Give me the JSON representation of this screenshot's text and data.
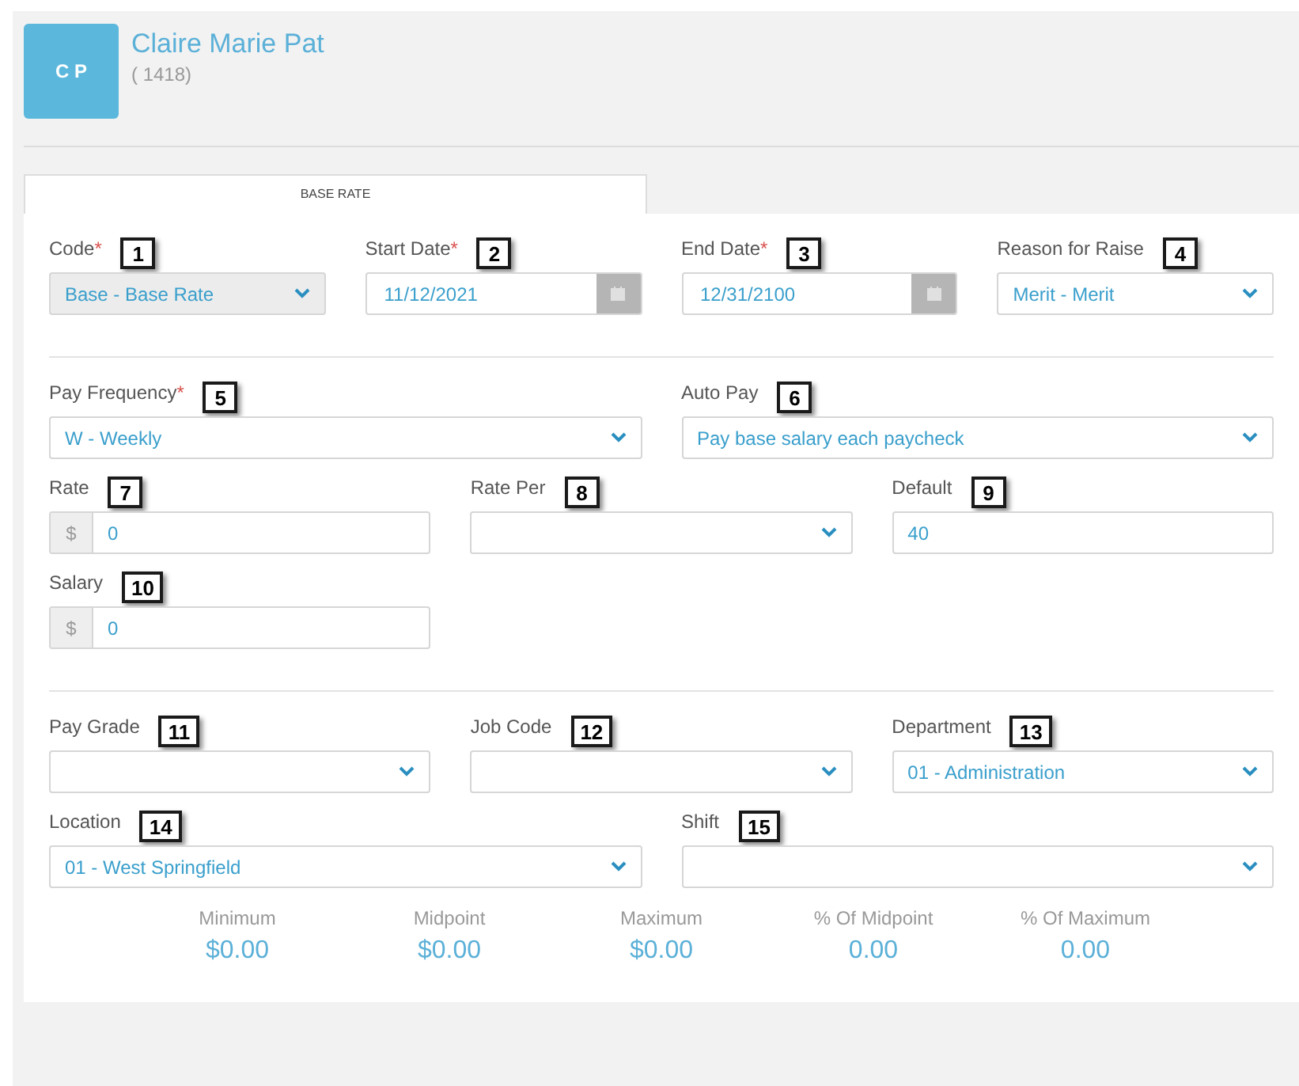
{
  "header": {
    "initials": "C P",
    "name": "Claire Marie Pat",
    "id": "( 1418)"
  },
  "tabs": [
    {
      "label": "BASE RATE",
      "selected": true
    }
  ],
  "sections": [
    {
      "rows": [
        {
          "fields": [
            {
              "kind": "select",
              "label": "Code",
              "required_mark": "*",
              "badge": "1",
              "value": "Base - Base Rate",
              "disabled": true
            },
            {
              "kind": "date",
              "label": "Start Date",
              "required_mark": "*",
              "badge": "2",
              "value": "11/12/2021",
              "disabled": false
            },
            {
              "kind": "date",
              "label": "End Date",
              "required_mark": "*",
              "badge": "3",
              "value": "12/31/2100",
              "disabled": false
            },
            {
              "kind": "select",
              "label": "Reason for Raise",
              "badge": "4",
              "value": "Merit - Merit",
              "disabled": false
            }
          ]
        }
      ]
    },
    {
      "rows": [
        {
          "fields": [
            {
              "kind": "select",
              "label": "Pay Frequency",
              "required_mark": "*",
              "badge": "5",
              "value": "W - Weekly",
              "disabled": false
            },
            {
              "kind": "select",
              "label": "Auto Pay",
              "badge": "6",
              "value": "Pay base salary each paycheck",
              "disabled": false
            }
          ]
        },
        {
          "fields": [
            {
              "kind": "money",
              "label": "Rate",
              "badge": "7",
              "prefix": "$",
              "value": "0",
              "disabled": false
            },
            {
              "kind": "select",
              "label": "Rate Per",
              "badge": "8",
              "disabled": false
            },
            {
              "kind": "text",
              "label": "Default",
              "badge": "9",
              "value": "40",
              "disabled": false
            }
          ]
        },
        {
          "fields": [
            {
              "kind": "money",
              "label": "Salary",
              "badge": "10",
              "prefix": "$",
              "value": "0",
              "disabled": false
            }
          ]
        }
      ]
    },
    {
      "rows": [
        {
          "fields": [
            {
              "kind": "select",
              "label": "Pay Grade",
              "badge": "11",
              "disabled": false
            },
            {
              "kind": "select",
              "label": "Job Code",
              "badge": "12",
              "disabled": false
            },
            {
              "kind": "select",
              "label": "Department",
              "badge": "13",
              "value": "01 - Administration",
              "disabled": false
            }
          ]
        },
        {
          "fields": [
            {
              "kind": "select",
              "label": "Location",
              "badge": "14",
              "value": "01 - West Springfield",
              "disabled": false
            },
            {
              "kind": "select",
              "label": "Shift",
              "badge": "15",
              "disabled": false
            }
          ]
        }
      ]
    }
  ],
  "stats": [
    {
      "label": "Minimum",
      "value": "$0.00"
    },
    {
      "label": "Midpoint",
      "value": "$0.00"
    },
    {
      "label": "Maximum",
      "value": "$0.00"
    },
    {
      "label": "% Of Midpoint",
      "value": "0.00"
    },
    {
      "label": "% Of Maximum",
      "value": "0.00"
    }
  ]
}
